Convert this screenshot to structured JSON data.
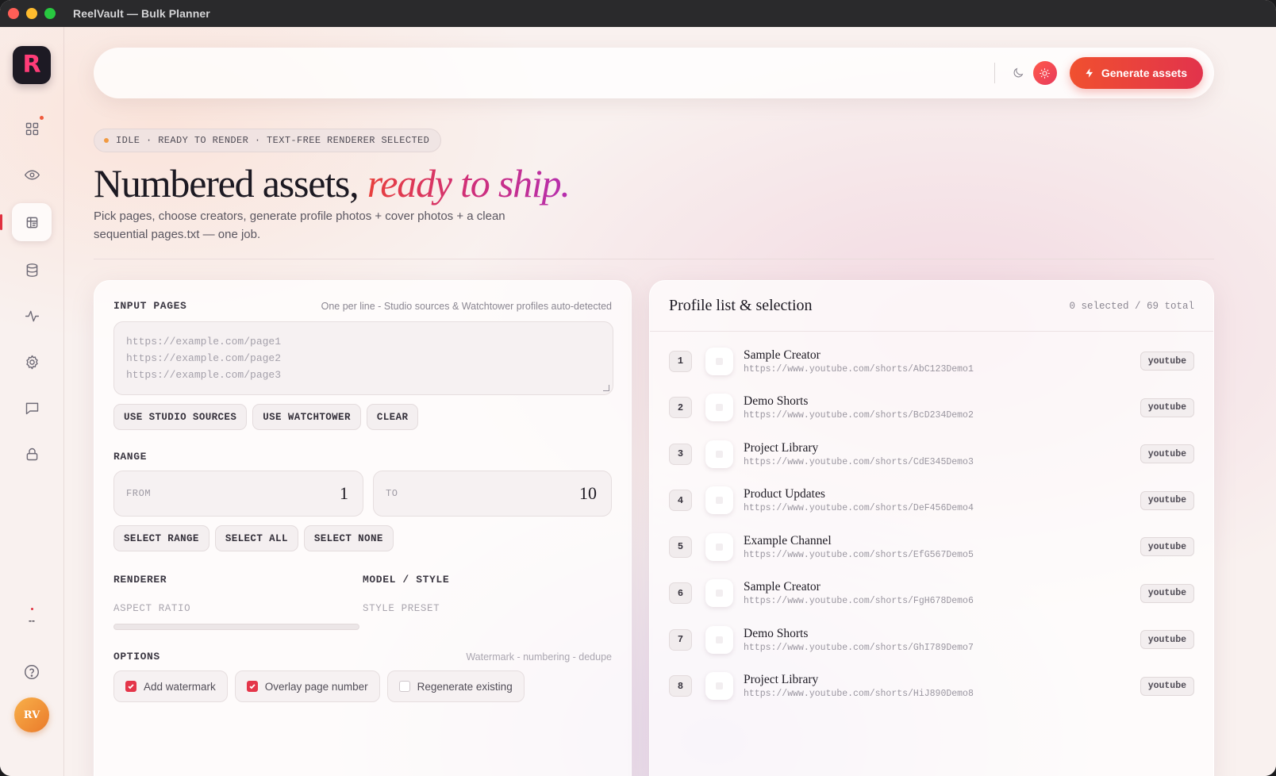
{
  "window": {
    "title": "ReelVault — Bulk Planner"
  },
  "sidebar": {
    "logo_letter": "R",
    "items": [
      {
        "icon": "grid-icon"
      },
      {
        "icon": "eye-icon"
      },
      {
        "icon": "planner-icon",
        "active": true
      },
      {
        "icon": "database-icon"
      },
      {
        "icon": "activity-icon"
      },
      {
        "icon": "gear-icon"
      },
      {
        "icon": "chat-icon"
      },
      {
        "icon": "lock-icon"
      }
    ],
    "mini_status": "--",
    "avatar_initials": "RV"
  },
  "topbar": {
    "generate_label": "Generate assets"
  },
  "status": "IDLE · READY TO RENDER · TEXT-FREE RENDERER SELECTED",
  "hero": {
    "title_plain": "Numbered assets, ",
    "title_accent": "ready to ship.",
    "subtitle": "Pick pages, choose creators, generate profile photos + cover photos + a clean sequential pages.txt — one job."
  },
  "input_pages": {
    "label": "INPUT PAGES",
    "hint": "One per line - Studio sources & Watchtower profiles auto-detected",
    "placeholder_lines": [
      "https://example.com/page1",
      "https://example.com/page2",
      "https://example.com/page3"
    ],
    "buttons": [
      "USE STUDIO SOURCES",
      "USE WATCHTOWER",
      "CLEAR"
    ]
  },
  "range": {
    "label": "RANGE",
    "from_label": "FROM",
    "from_value": "1",
    "to_label": "TO",
    "to_value": "10",
    "buttons": [
      "SELECT RANGE",
      "SELECT ALL",
      "SELECT NONE"
    ]
  },
  "renderer": {
    "label": "RENDERER",
    "sublabel": "ASPECT RATIO"
  },
  "model": {
    "label": "MODEL / STYLE",
    "sublabel": "STYLE PRESET"
  },
  "options": {
    "label": "OPTIONS",
    "hint": "Watermark - numbering - dedupe",
    "items": [
      {
        "label": "Add watermark",
        "checked": true
      },
      {
        "label": "Overlay page number",
        "checked": true
      },
      {
        "label": "Regenerate existing",
        "checked": false
      }
    ]
  },
  "profiles": {
    "title": "Profile list & selection",
    "count": "0 selected / 69 total",
    "rows": [
      {
        "num": "1",
        "name": "Sample Creator",
        "url": "https://www.youtube.com/shorts/AbC123Demo1",
        "tag": "youtube"
      },
      {
        "num": "2",
        "name": "Demo Shorts",
        "url": "https://www.youtube.com/shorts/BcD234Demo2",
        "tag": "youtube"
      },
      {
        "num": "3",
        "name": "Project Library",
        "url": "https://www.youtube.com/shorts/CdE345Demo3",
        "tag": "youtube"
      },
      {
        "num": "4",
        "name": "Product Updates",
        "url": "https://www.youtube.com/shorts/DeF456Demo4",
        "tag": "youtube"
      },
      {
        "num": "5",
        "name": "Example Channel",
        "url": "https://www.youtube.com/shorts/EfG567Demo5",
        "tag": "youtube"
      },
      {
        "num": "6",
        "name": "Sample Creator",
        "url": "https://www.youtube.com/shorts/FgH678Demo6",
        "tag": "youtube"
      },
      {
        "num": "7",
        "name": "Demo Shorts",
        "url": "https://www.youtube.com/shorts/GhI789Demo7",
        "tag": "youtube"
      },
      {
        "num": "8",
        "name": "Project Library",
        "url": "https://www.youtube.com/shorts/HiJ890Demo8",
        "tag": "youtube"
      }
    ]
  },
  "colors": {
    "accent": "#e4364a",
    "accent_orange": "#f0502f"
  }
}
